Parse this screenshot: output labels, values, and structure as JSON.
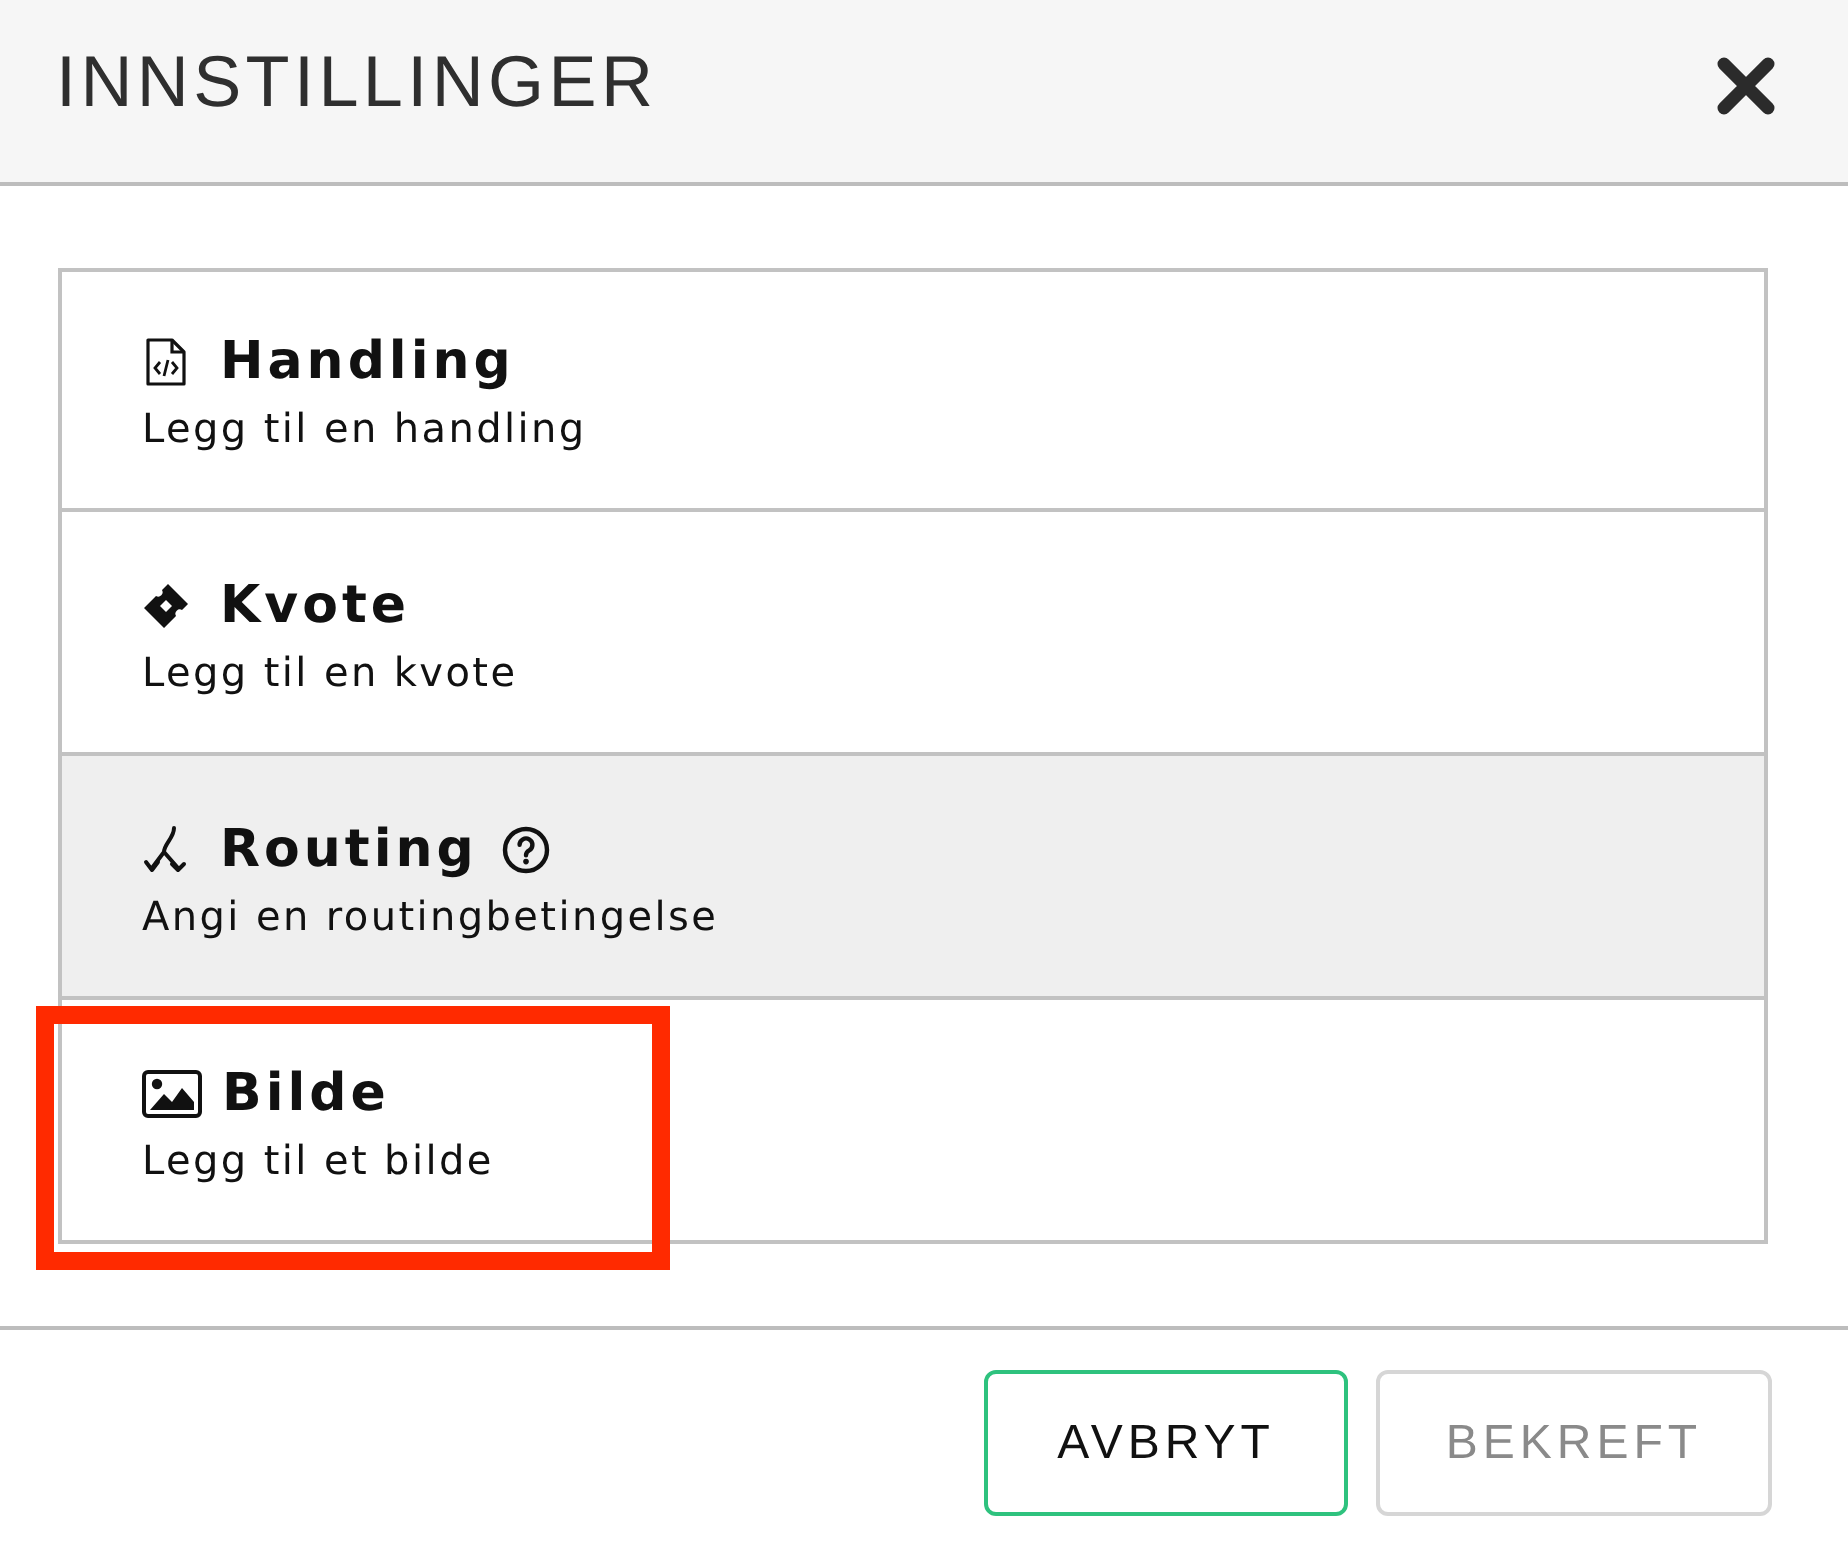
{
  "dialog": {
    "title": "INNSTILLINGER"
  },
  "options": [
    {
      "kind": "action",
      "title": "Handling",
      "description": "Legg til en handling",
      "help": false,
      "hovered": false,
      "highlighted": false
    },
    {
      "kind": "quota",
      "title": "Kvote",
      "description": "Legg til en kvote",
      "help": false,
      "hovered": false,
      "highlighted": false
    },
    {
      "kind": "routing",
      "title": "Routing",
      "description": "Angi en routingbetingelse",
      "help": true,
      "hovered": true,
      "highlighted": false
    },
    {
      "kind": "image",
      "title": "Bilde",
      "description": "Legg til et bilde",
      "help": false,
      "hovered": false,
      "highlighted": true
    }
  ],
  "buttons": [
    {
      "label": "AVBRYT",
      "focused": true,
      "disabled": false
    },
    {
      "label": "BEKREFT",
      "focused": false,
      "disabled": true
    }
  ]
}
